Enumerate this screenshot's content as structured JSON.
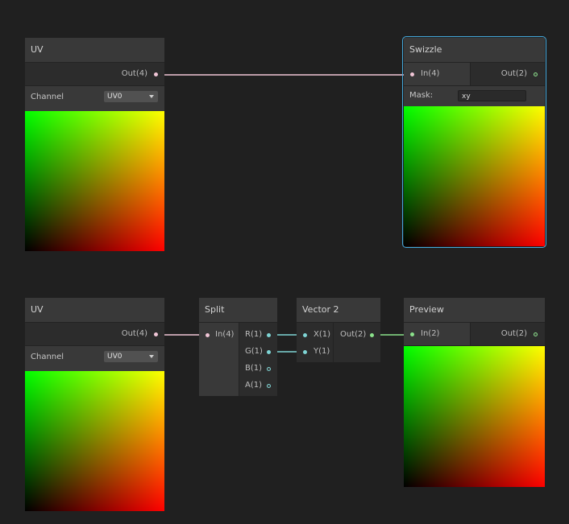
{
  "nodes": {
    "uv_top": {
      "title": "UV",
      "out_label": "Out(4)",
      "channel_label": "Channel",
      "channel_value": "UV0"
    },
    "swizzle": {
      "title": "Swizzle",
      "in_label": "In(4)",
      "out_label": "Out(2)",
      "mask_label": "Mask:",
      "mask_value": "xy"
    },
    "uv_bottom": {
      "title": "UV",
      "out_label": "Out(4)",
      "channel_label": "Channel",
      "channel_value": "UV0"
    },
    "split": {
      "title": "Split",
      "in_label": "In(4)",
      "outputs": [
        "R(1)",
        "G(1)",
        "B(1)",
        "A(1)"
      ]
    },
    "vector2": {
      "title": "Vector 2",
      "inputs": [
        "X(1)",
        "Y(1)"
      ],
      "out_label": "Out(2)"
    },
    "preview": {
      "title": "Preview",
      "in_label": "In(2)",
      "out_label": "Out(2)"
    }
  },
  "colors": {
    "wire_vec4": "#f0c5d6",
    "wire_float": "#7fd5d5",
    "wire_vec2": "#8be28b",
    "selection": "#44a8db"
  }
}
